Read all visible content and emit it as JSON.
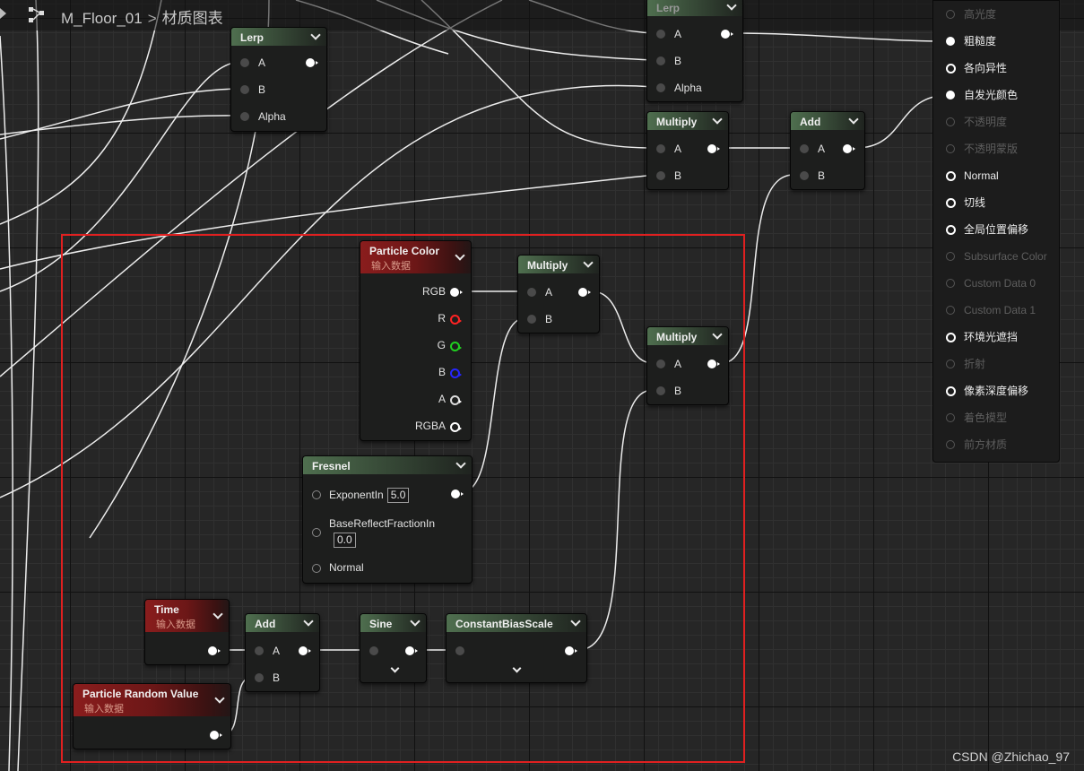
{
  "breadcrumb": {
    "asset": "M_Floor_01",
    "separator": ">",
    "graph": "材质图表"
  },
  "nodes": {
    "lerp1": {
      "title": "Lerp",
      "a": "A",
      "b": "B",
      "alpha": "Alpha"
    },
    "lerp2": {
      "title": "Lerp",
      "a": "A",
      "b": "B",
      "alpha": "Alpha"
    },
    "multiply_top": {
      "title": "Multiply",
      "a": "A",
      "b": "B"
    },
    "add_top": {
      "title": "Add",
      "a": "A",
      "b": "B"
    },
    "particle_color": {
      "title": "Particle Color",
      "subtitle": "输入数据",
      "rgb": "RGB",
      "r": "R",
      "g": "G",
      "b": "B",
      "a": "A",
      "rgba": "RGBA"
    },
    "multiply_mid": {
      "title": "Multiply",
      "a": "A",
      "b": "B"
    },
    "multiply_right": {
      "title": "Multiply",
      "a": "A",
      "b": "B"
    },
    "fresnel": {
      "title": "Fresnel",
      "exponent_label": "ExponentIn",
      "exponent_value": "5.0",
      "base_label": "BaseReflectFractionIn",
      "base_value": "0.0",
      "normal_label": "Normal"
    },
    "time": {
      "title": "Time",
      "subtitle": "输入数据"
    },
    "add_bottom": {
      "title": "Add",
      "a": "A",
      "b": "B"
    },
    "sine": {
      "title": "Sine"
    },
    "cbs": {
      "title": "ConstantBiasScale"
    },
    "prv": {
      "title": "Particle Random Value",
      "subtitle": "输入数据"
    }
  },
  "material_inputs": [
    {
      "label": "高光度",
      "enabled": false
    },
    {
      "label": "粗糙度",
      "enabled": true
    },
    {
      "label": "各向异性",
      "enabled": true
    },
    {
      "label": "自发光颜色",
      "enabled": true
    },
    {
      "label": "不透明度",
      "enabled": false
    },
    {
      "label": "不透明蒙版",
      "enabled": false
    },
    {
      "label": "Normal",
      "enabled": true
    },
    {
      "label": "切线",
      "enabled": true
    },
    {
      "label": "全局位置偏移",
      "enabled": true
    },
    {
      "label": "Subsurface Color",
      "enabled": false
    },
    {
      "label": "Custom Data 0",
      "enabled": false
    },
    {
      "label": "Custom Data 1",
      "enabled": false
    },
    {
      "label": "环境光遮挡",
      "enabled": true
    },
    {
      "label": "折射",
      "enabled": false
    },
    {
      "label": "像素深度偏移",
      "enabled": true
    },
    {
      "label": "着色模型",
      "enabled": false
    },
    {
      "label": "前方材质",
      "enabled": false
    }
  ],
  "watermark": "CSDN @Zhichao_97",
  "colors": {
    "selection": "#e02020",
    "node_header": "#4f6f4f",
    "input_node_header": "#8a1d1d"
  }
}
